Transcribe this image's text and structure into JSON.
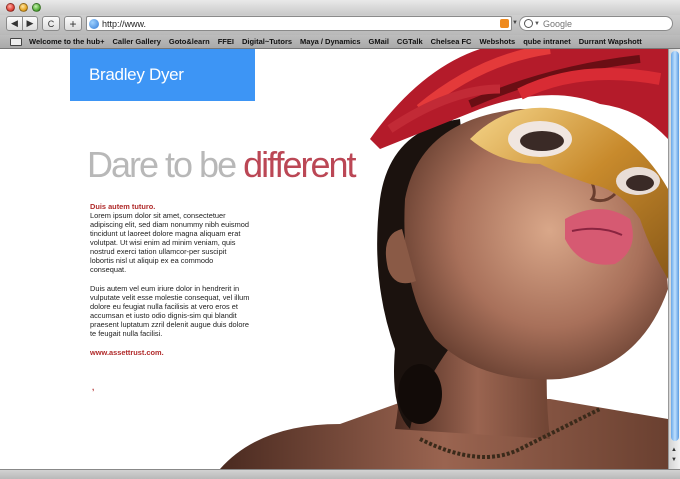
{
  "browser": {
    "url": "http://www.",
    "search_placeholder": "Google",
    "back_icon": "◀",
    "forward_icon": "▶",
    "reload_icon": "C",
    "add_icon": "+"
  },
  "bookmarks": [
    "Welcome to the hub+",
    "Caller Gallery",
    "Goto&learn",
    "FFEI",
    "Digital~Tutors",
    "Maya / Dynamics",
    "GMail",
    "CGTalk",
    "Chelsea FC",
    "Webshots",
    "qube intranet",
    "Durrant Wapshott"
  ],
  "site": {
    "name": "Bradley Dyer",
    "headline_part1": "Dare to be ",
    "headline_part2": "different",
    "lead": "Duis autem tuturo.",
    "paragraph1": "Lorem ipsum dolor sit amet, consectetuer adipiscing elit, sed diam nonummy nibh euismod tincidunt ut laoreet dolore magna aliquam erat volutpat.  Ut wisi enim ad minim veniam, quis nostrud exerci tation ullamcor-per suscipit lobortis nisl ut aliquip ex ea commodo consequat.",
    "paragraph2": "Duis autem vel eum iriure dolor in hendrerit in vulputate velit esse molestie consequat, vel illum dolore eu feugiat nulla facilisis at vero eros et accumsan et iusto odio dignis-sim qui blandit praesent luptatum zzril delenit augue duis dolore te feugait nulla facilisi.",
    "link": "www.assettrust.com.",
    "bullet": ","
  },
  "colors": {
    "name_box": "#3d95f5",
    "headline_grey": "#b8b8b8",
    "headline_red": "#bb4755",
    "accent_red": "#b02a2a"
  }
}
